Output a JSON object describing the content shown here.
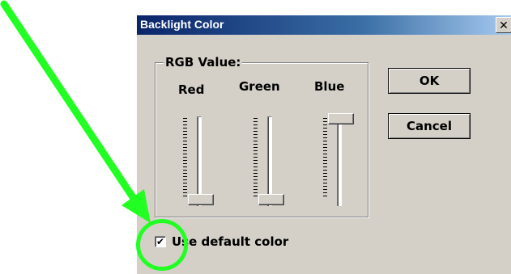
{
  "window": {
    "title": "Backlight Color",
    "close_glyph": "✕"
  },
  "group": {
    "label": "RGB Value:",
    "channels": [
      {
        "label": "Red",
        "level": 0.0
      },
      {
        "label": "Green",
        "level": 0.0
      },
      {
        "label": "Blue",
        "level": 1.0
      }
    ]
  },
  "buttons": {
    "ok": "OK",
    "cancel": "Cancel"
  },
  "checkbox": {
    "label": "Use default color",
    "checked": true,
    "check_glyph": "✔"
  },
  "annotation": {
    "color": "#22ff22",
    "icon": "arrow-and-circle"
  }
}
